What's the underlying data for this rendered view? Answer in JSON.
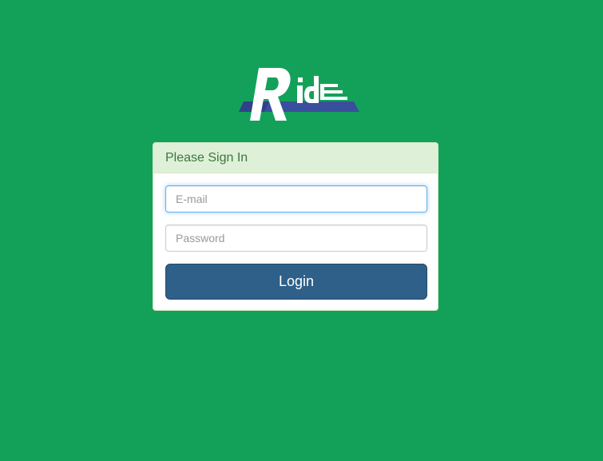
{
  "brand": {
    "logo_text": "Ride",
    "colors": {
      "background": "#13a15a",
      "logo_letters": "#ffffff",
      "logo_base": "#3a4f9c"
    }
  },
  "login_panel": {
    "heading": "Please Sign In",
    "email": {
      "placeholder": "E-mail",
      "value": ""
    },
    "password": {
      "placeholder": "Password",
      "value": ""
    },
    "login_label": "Login",
    "colors": {
      "heading_bg": "#dff0d8",
      "heading_text": "#3c763d",
      "button_bg": "#2e6089"
    }
  }
}
